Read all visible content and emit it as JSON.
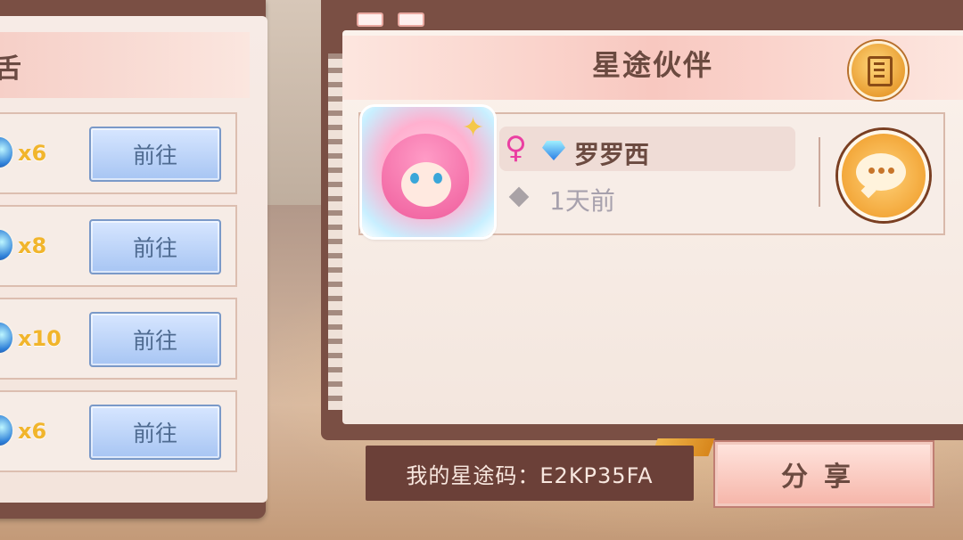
{
  "left_panel": {
    "title_fragment": "舌",
    "tasks": [
      {
        "count": "x6",
        "button": "前往"
      },
      {
        "count": "x8",
        "button": "前往"
      },
      {
        "count": "x10",
        "button": "前往"
      },
      {
        "count": "x6",
        "button": "前往"
      }
    ]
  },
  "partner_panel": {
    "title": "星途伙伴",
    "partner": {
      "gender_symbol": "♀",
      "name": "罗罗西",
      "last_seen": "1天前"
    }
  },
  "footer": {
    "code_label": "我的星途码：E2KP35FA",
    "share_label": "分享"
  },
  "icons": {
    "gender": "female-icon",
    "vip": "diamond-vip-icon",
    "list": "list-icon",
    "chat": "chat-bubble-icon",
    "reward": "gem-icon"
  },
  "colors": {
    "frame": "#7a4f44",
    "paper": "#f7ede7",
    "accent_gold": "#f1b52c",
    "button_blue": "#a7c5f3",
    "gender_pink": "#ea3fa2"
  }
}
